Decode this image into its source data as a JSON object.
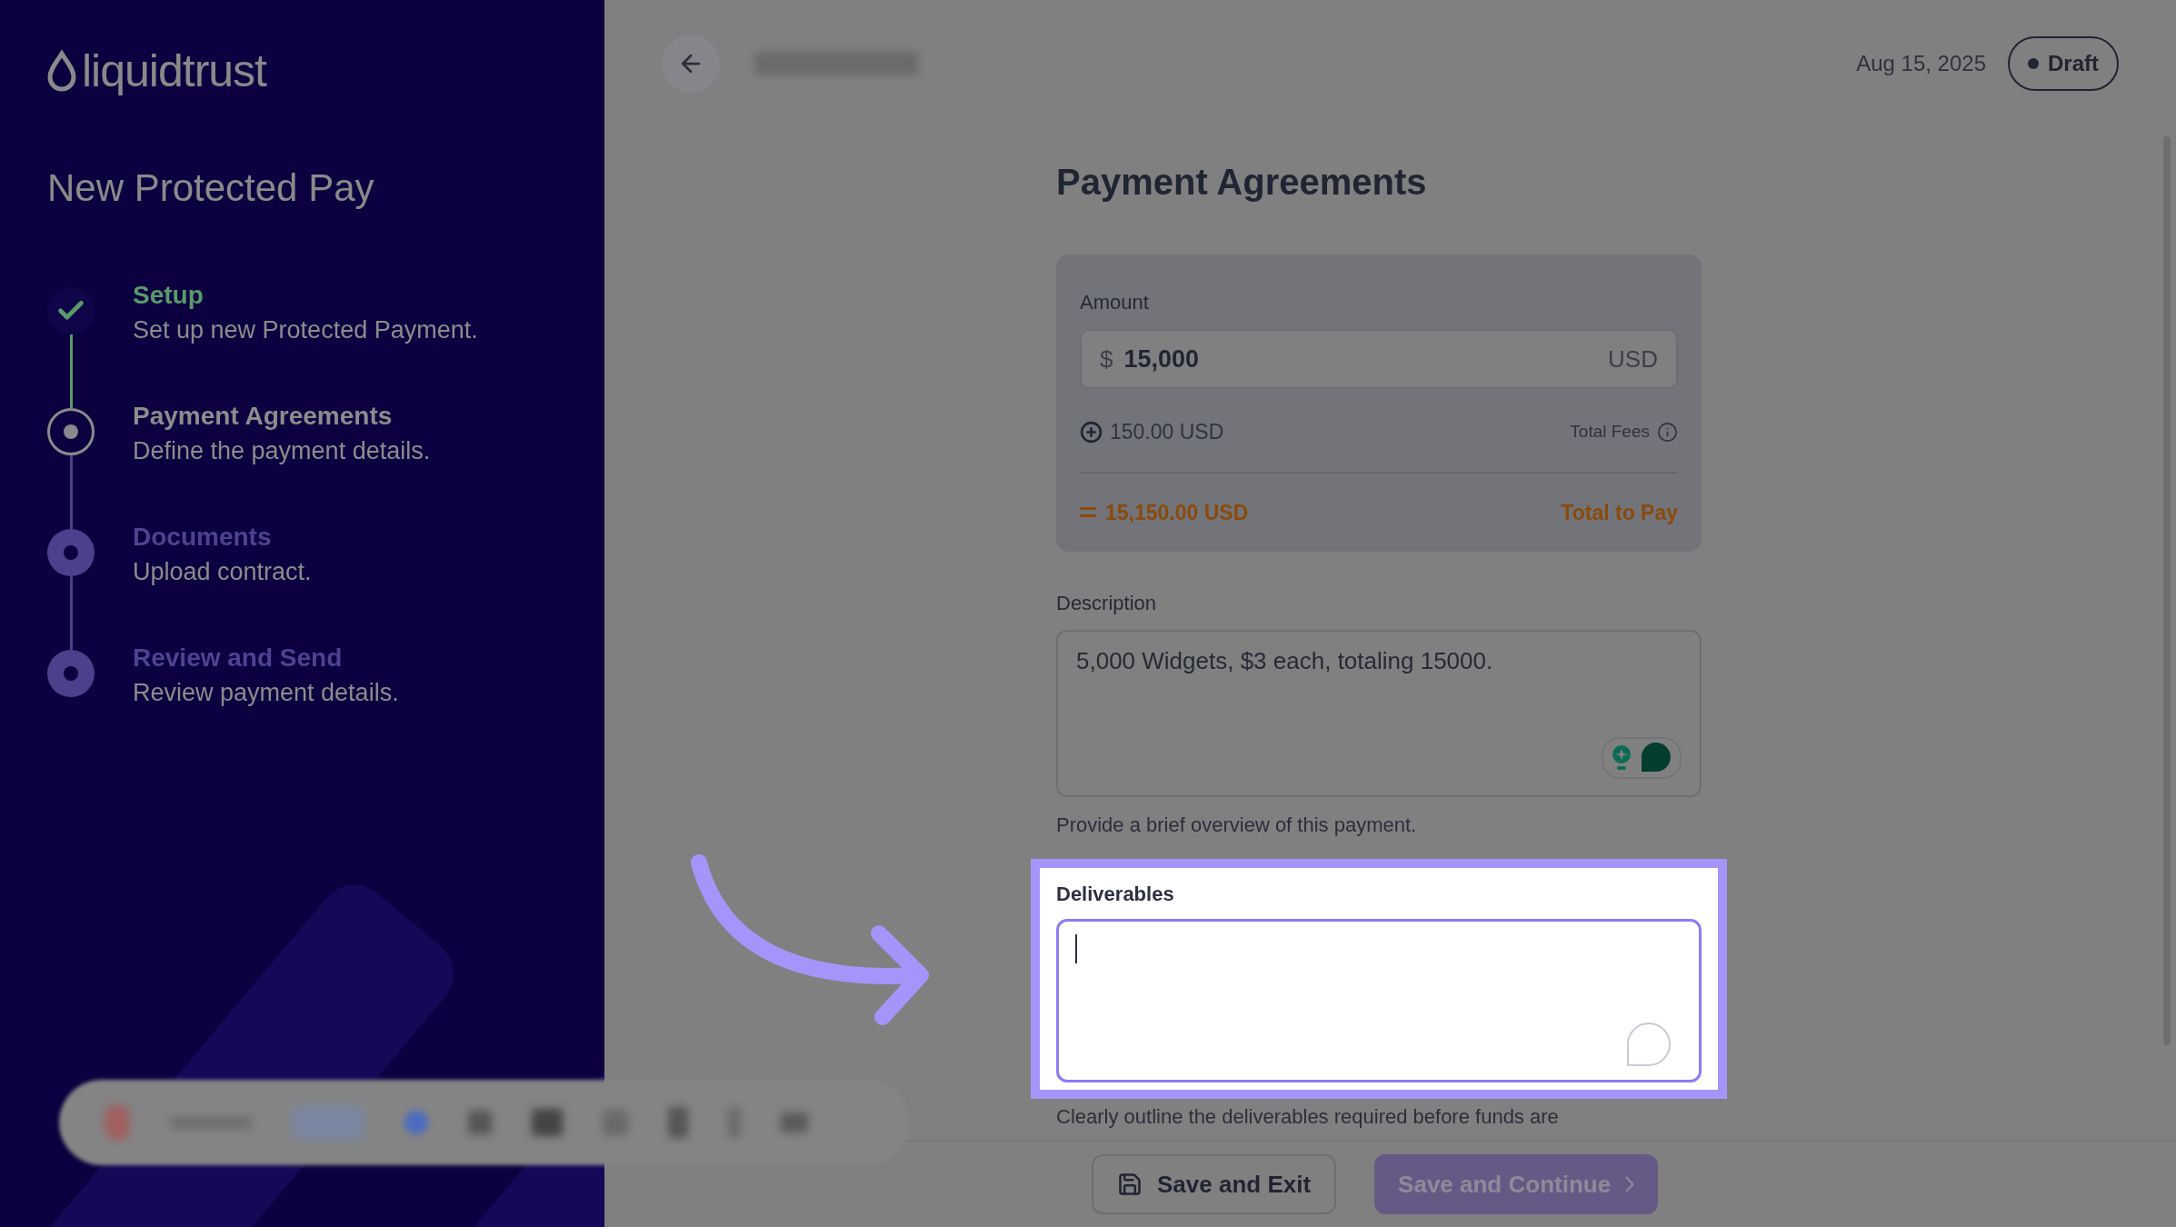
{
  "brand": {
    "name": "liquidtrust"
  },
  "sidebar": {
    "title": "New Protected Pay",
    "steps": [
      {
        "title": "Setup",
        "description": "Set up new Protected Payment.",
        "kind": "done"
      },
      {
        "title": "Payment Agreements",
        "description": "Define the payment details.",
        "kind": "current"
      },
      {
        "title": "Documents",
        "description": "Upload contract.",
        "kind": "upcoming"
      },
      {
        "title": "Review and Send",
        "description": "Review payment details.",
        "kind": "upcoming"
      }
    ]
  },
  "header": {
    "date": "Aug 15, 2025",
    "status_badge": "Draft"
  },
  "form": {
    "title": "Payment Agreements",
    "amount": {
      "label": "Amount",
      "currency_symbol": "$",
      "value": "15,000",
      "currency": "USD",
      "fee": "150.00 USD",
      "fee_label": "Total Fees",
      "total": "15,150.00 USD",
      "total_label": "Total to Pay"
    },
    "description": {
      "label": "Description",
      "value": "5,000 Widgets, $3 each, totaling 15000.",
      "hint": "Provide a brief overview of this payment."
    },
    "deliverables": {
      "label": "Deliverables",
      "focused": true,
      "hint": "Clearly outline the deliverables required before funds are"
    }
  },
  "footer": {
    "buttons": [
      {
        "label": "Save and Exit",
        "kind": "secondary",
        "disabled": false
      },
      {
        "label": "Save and Continue",
        "kind": "primary",
        "disabled": true
      }
    ]
  }
}
